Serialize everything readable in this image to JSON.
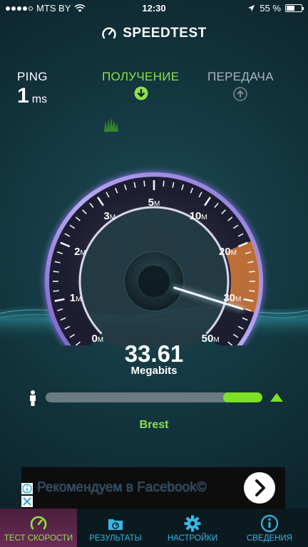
{
  "status_bar": {
    "carrier": "MTS BY",
    "time": "12:30",
    "battery": "55 %",
    "battery_level": 0.55,
    "signal_bars": 4
  },
  "header": {
    "title": "SPEEDTEST"
  },
  "metrics": {
    "ping_label": "PING",
    "ping_value": "1",
    "ping_unit": "ms",
    "download_label": "ПОЛУЧЕНИЕ",
    "upload_label": "ПЕРЕДАЧА"
  },
  "gauge": {
    "scale_labels": [
      {
        "value": "0",
        "unit": "M"
      },
      {
        "value": "1",
        "unit": "M"
      },
      {
        "value": "2",
        "unit": "M"
      },
      {
        "value": "3",
        "unit": "M"
      },
      {
        "value": "5",
        "unit": "M"
      },
      {
        "value": "10",
        "unit": "M"
      },
      {
        "value": "20",
        "unit": "M"
      },
      {
        "value": "30",
        "unit": "M"
      },
      {
        "value": "50",
        "unit": "M"
      }
    ],
    "speed": "33.61",
    "speed_unit": "Megabits",
    "needle_speed": 33.61
  },
  "progress": {
    "fraction": 0.18
  },
  "server": {
    "name": "Brest"
  },
  "ad": {
    "text": "Рекомендуем в Facebook©"
  },
  "tabs": [
    {
      "label": "ТЕСТ СКОРОСТИ",
      "icon": "speedometer-icon",
      "active": true
    },
    {
      "label": "РЕЗУЛЬТАТЫ",
      "icon": "results-icon",
      "active": false
    },
    {
      "label": "НАСТРОЙКИ",
      "icon": "gear-icon",
      "active": false
    },
    {
      "label": "СВЕДЕНИЯ",
      "icon": "info-icon",
      "active": false
    }
  ],
  "colors": {
    "accent_green": "#8fe04a",
    "tab_blue": "#35b8e8",
    "gauge_orange": "#f08a3a"
  }
}
